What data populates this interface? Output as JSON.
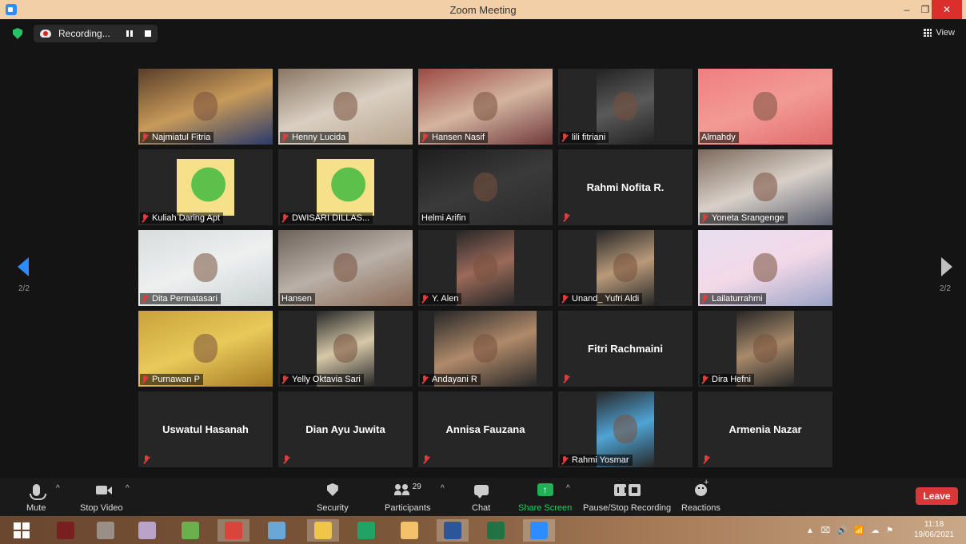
{
  "window": {
    "title": "Zoom Meeting",
    "minimize": "–",
    "restore": "❐",
    "close": "✕"
  },
  "recording": {
    "label": "Recording..."
  },
  "view": {
    "label": "View"
  },
  "pagination": {
    "left": "2/2",
    "right": "2/2"
  },
  "participants_grid": [
    {
      "name": "Najmiatul Fitria",
      "video": true,
      "muted": true,
      "bg": [
        "#5a3e2a",
        "#c79a5a",
        "#2a3a6a"
      ]
    },
    {
      "name": "Henny Lucida",
      "video": true,
      "muted": true,
      "bg": [
        "#8a7663",
        "#d9cfc2",
        "#b8a58d"
      ]
    },
    {
      "name": "Hansen Nasif",
      "video": true,
      "muted": true,
      "bg": [
        "#9b4a43",
        "#d4b4a0",
        "#6f3a3a"
      ]
    },
    {
      "name": "lili fitriani",
      "video": true,
      "muted": true,
      "bg": [
        "#222222",
        "#5a5a5a",
        "#222222"
      ],
      "narrow": true
    },
    {
      "name": "Almahdy",
      "video": true,
      "muted": false,
      "bg": [
        "#ee7f7f",
        "#f39a95",
        "#e06c6c"
      ]
    },
    {
      "name": "Kuliah Daring Apt",
      "video": true,
      "muted": true,
      "bg": [
        "#262626",
        "#7fcf6b",
        "#262626"
      ],
      "logo": true
    },
    {
      "name": "DWISARI DILLAS...",
      "video": true,
      "muted": true,
      "bg": [
        "#262626",
        "#7fcf6b",
        "#262626"
      ],
      "logo": true
    },
    {
      "name": "Helmi Arifin",
      "video": true,
      "muted": false,
      "bg": [
        "#1d1d1d",
        "#3a3a3a",
        "#2a2a2a"
      ]
    },
    {
      "name": "Rahmi Nofita R.",
      "video": false,
      "muted": true
    },
    {
      "name": "Yoneta Srangenge",
      "video": true,
      "muted": true,
      "bg": [
        "#7c6a5c",
        "#d8d0c8",
        "#5c6070"
      ]
    },
    {
      "name": "Dita Permatasari",
      "video": true,
      "muted": true,
      "bg": [
        "#d7dcdc",
        "#eef0f0",
        "#c9d0d0"
      ]
    },
    {
      "name": "Hansen",
      "video": true,
      "muted": false,
      "bg": [
        "#6d625a",
        "#b9b0a8",
        "#8a6a55"
      ]
    },
    {
      "name": "Y. Alen",
      "video": true,
      "muted": true,
      "bg": [
        "#262626",
        "#9b6a5a",
        "#262626"
      ],
      "narrow": true
    },
    {
      "name": "Unand_ Yufri Aldi",
      "video": true,
      "muted": true,
      "bg": [
        "#262626",
        "#b99a7a",
        "#262626"
      ],
      "narrow": true
    },
    {
      "name": "Lailaturrahmi",
      "video": true,
      "muted": true,
      "bg": [
        "#e6dff0",
        "#f3d9e8",
        "#9aa3c6"
      ]
    },
    {
      "name": "Purnawan P",
      "video": true,
      "muted": true,
      "bg": [
        "#c9a23a",
        "#e8c95a",
        "#a67a22"
      ]
    },
    {
      "name": "Yelly Oktavia Sari",
      "video": true,
      "muted": true,
      "bg": [
        "#262626",
        "#d6c9a9",
        "#262626"
      ],
      "narrow": true
    },
    {
      "name": "Andayani R",
      "video": true,
      "muted": true,
      "bg": [
        "#262626",
        "#b08a6a",
        "#262626"
      ],
      "wide": true
    },
    {
      "name": "Fitri Rachmaini",
      "video": false,
      "muted": true
    },
    {
      "name": "Dira Hefni",
      "video": true,
      "muted": true,
      "bg": [
        "#262626",
        "#a88a6a",
        "#262626"
      ],
      "narrow": true
    },
    {
      "name": "Uswatul Hasanah",
      "video": false,
      "muted": true
    },
    {
      "name": "Dian Ayu Juwita",
      "video": false,
      "muted": true
    },
    {
      "name": "Annisa Fauzana",
      "video": false,
      "muted": true
    },
    {
      "name": "Rahmi Yosmar",
      "video": true,
      "muted": true,
      "bg": [
        "#262626",
        "#4fa4d6",
        "#262626"
      ],
      "narrow": true
    },
    {
      "name": "Armenia Nazar",
      "video": false,
      "muted": true
    }
  ],
  "toolbar": {
    "mute": "Mute",
    "stop_video": "Stop Video",
    "security": "Security",
    "participants": "Participants",
    "participants_count": "29",
    "chat": "Chat",
    "share_screen": "Share Screen",
    "share_glyph": "↑",
    "pause_stop_recording": "Pause/Stop Recording",
    "reactions": "Reactions",
    "leave": "Leave",
    "caret": "^",
    "share_color": "#1fb154",
    "leave_color": "#d93838"
  },
  "taskbar": {
    "apps": [
      {
        "name": "kbbi-app-icon",
        "color": "#7a1f1f",
        "active": false
      },
      {
        "name": "window-manager-icon",
        "color": "#9a8f86",
        "active": false
      },
      {
        "name": "paint-icon",
        "color": "#b9a3c8",
        "active": false
      },
      {
        "name": "folder-sync-icon",
        "color": "#6ab04c",
        "active": false
      },
      {
        "name": "chrome-icon",
        "color": "#d9443b",
        "active": true
      },
      {
        "name": "notepad-icon",
        "color": "#6aa7d6",
        "active": false
      },
      {
        "name": "file-explorer-icon",
        "color": "#f0c64a",
        "active": true
      },
      {
        "name": "calculator-icon",
        "color": "#21a366",
        "active": false
      },
      {
        "name": "tools-icon",
        "color": "#f2c26a",
        "active": false
      },
      {
        "name": "word-icon",
        "color": "#2b579a",
        "active": true
      },
      {
        "name": "excel-icon",
        "color": "#217346",
        "active": false
      },
      {
        "name": "zoom-icon",
        "color": "#2d8cff",
        "active": true
      }
    ],
    "tray_glyphs": "▲ ⌧ 🔊 📶 ☁ ⚑",
    "time": "11:18",
    "date": "19/06/2021"
  }
}
